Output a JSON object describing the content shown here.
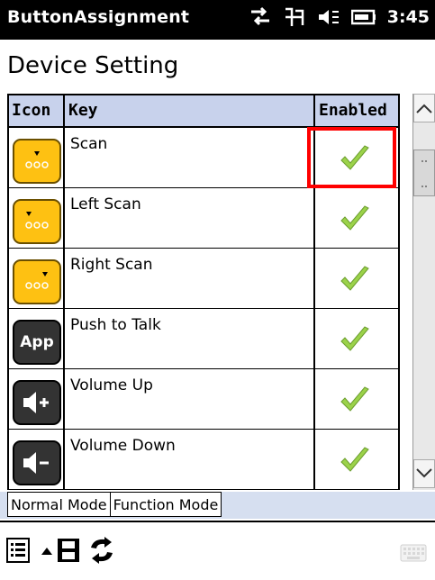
{
  "titlebar": {
    "app_title": "ButtonAssignment",
    "time": "3:45"
  },
  "page_title": "Device Setting",
  "table": {
    "headers": {
      "icon": "Icon",
      "key": "Key",
      "enabled": "Enabled"
    },
    "rows": [
      {
        "key": "Scan",
        "icon": "scan-icon",
        "icon_label": "",
        "enabled": true
      },
      {
        "key": "Left Scan",
        "icon": "left-scan-icon",
        "icon_label": "",
        "enabled": true
      },
      {
        "key": "Right Scan",
        "icon": "right-scan-icon",
        "icon_label": "",
        "enabled": true
      },
      {
        "key": "Push to Talk",
        "icon": "app-icon",
        "icon_label": "App",
        "enabled": true
      },
      {
        "key": "Volume Up",
        "icon": "volume-up-icon",
        "icon_label": "",
        "enabled": true
      },
      {
        "key": "Volume Down",
        "icon": "volume-down-icon",
        "icon_label": "",
        "enabled": true
      }
    ]
  },
  "tabs": [
    {
      "label": "Normal Mode",
      "selected": true
    },
    {
      "label": "Function Mode",
      "selected": false
    }
  ],
  "colors": {
    "header_bg": "#c8d2ec",
    "scan_icon": "#fec112",
    "check_green": "#9bd24a",
    "highlight": "#ff0000"
  }
}
